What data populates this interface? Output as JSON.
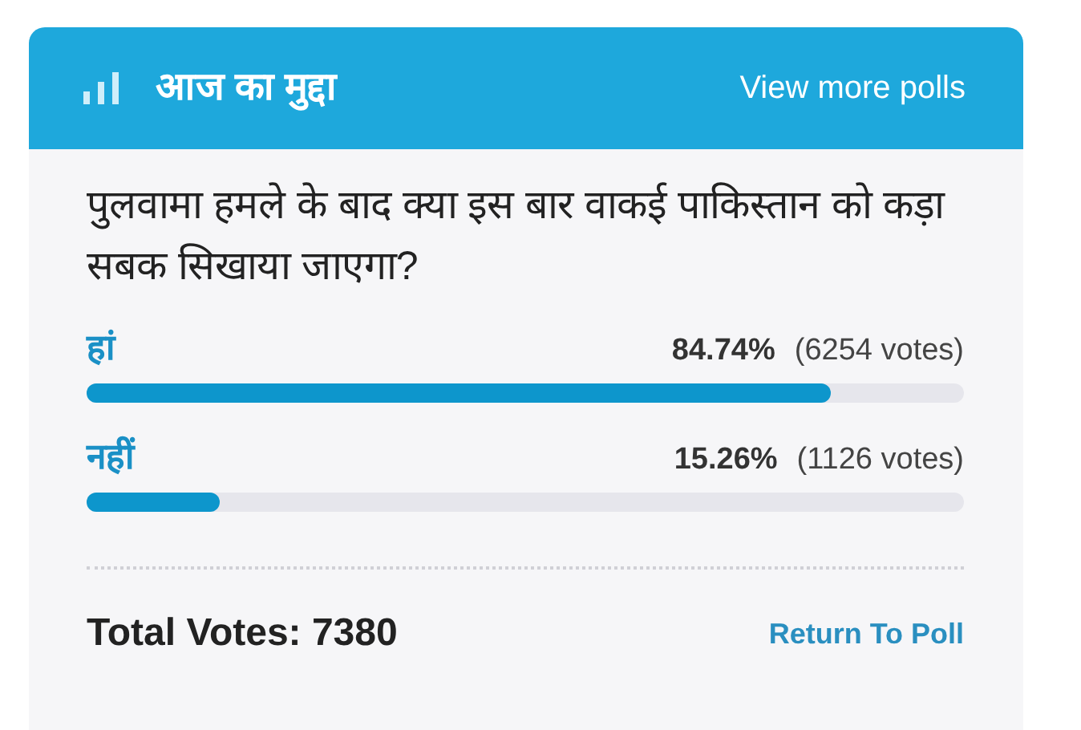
{
  "header": {
    "title": "आज का मुद्दा",
    "link": "View more polls"
  },
  "question": "पुलवामा हमले के बाद क्या इस बार वाकई पाकिस्तान को कड़ा सबक सिखाया जाएगा?",
  "options": [
    {
      "label": "हां",
      "percent": "84.74%",
      "votes": "(6254 votes)",
      "level": 0.8474
    },
    {
      "label": "नहीं",
      "percent": "15.26%",
      "votes": "(1126 votes)",
      "level": 0.1526
    }
  ],
  "footer": {
    "total": "Total Votes: 7380",
    "link": "Return To Poll"
  }
}
